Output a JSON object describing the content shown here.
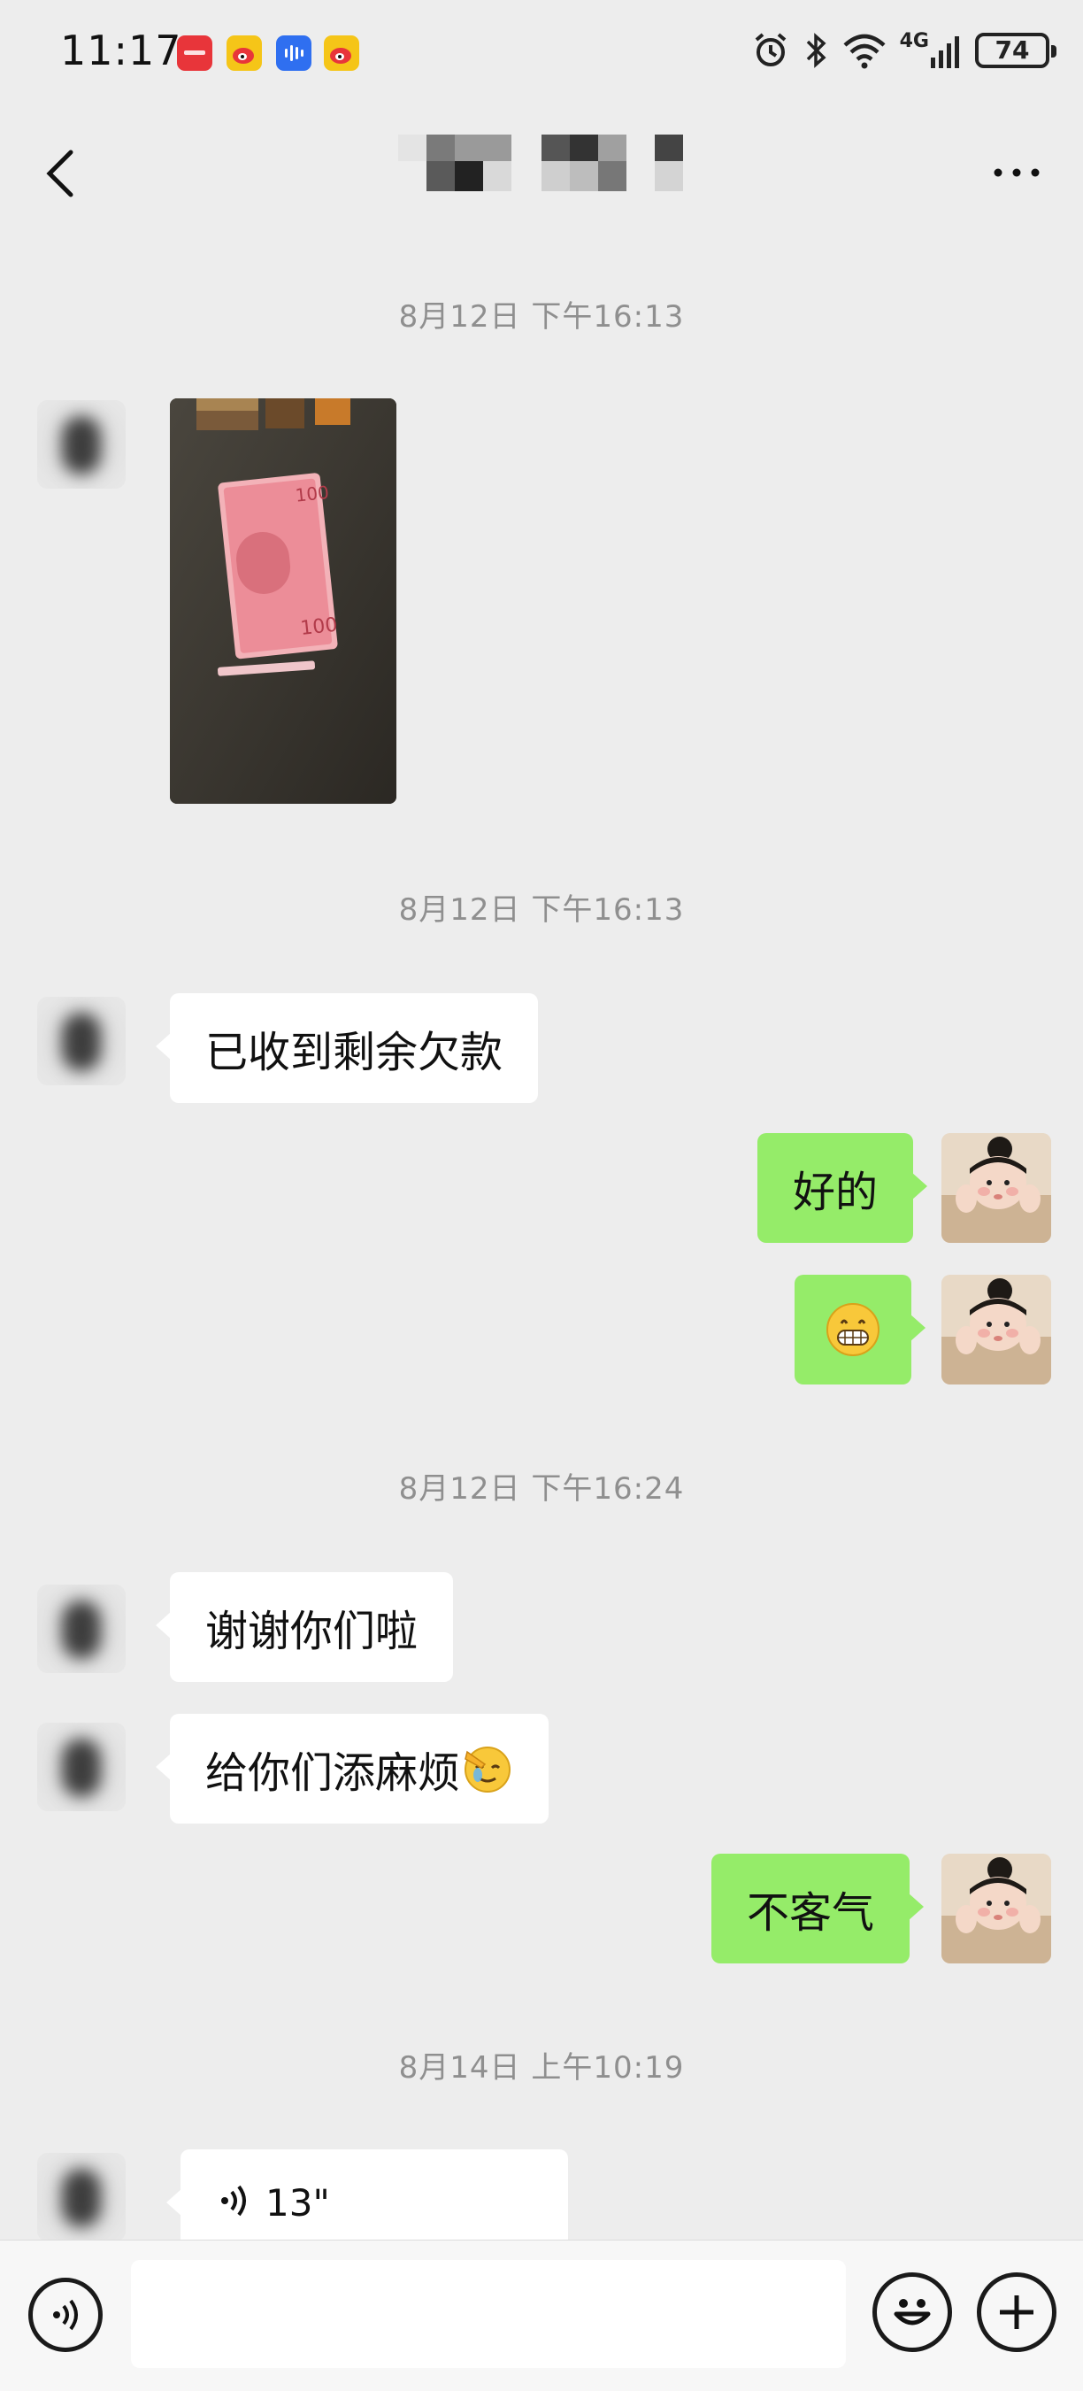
{
  "status_bar": {
    "time": "11:17",
    "network": "4G",
    "battery": "74"
  },
  "nav": {
    "title": ""
  },
  "messages": [
    {
      "type": "timestamp",
      "text": "8月12日 下午16:13"
    },
    {
      "type": "image",
      "sender": "other",
      "description": "photo of RMB 100 yuan banknotes on table"
    },
    {
      "type": "timestamp",
      "text": "8月12日 下午16:13"
    },
    {
      "type": "text",
      "sender": "other",
      "text": "已收到剩余欠款"
    },
    {
      "type": "text",
      "sender": "me",
      "text": "好的"
    },
    {
      "type": "emoji",
      "sender": "me",
      "emoji": "grinning-face"
    },
    {
      "type": "timestamp",
      "text": "8月12日 下午16:24"
    },
    {
      "type": "text",
      "sender": "other",
      "text": "谢谢你们啦"
    },
    {
      "type": "text",
      "sender": "other",
      "text": "给你们添麻烦",
      "emoji": "facepalm"
    },
    {
      "type": "text",
      "sender": "me",
      "text": "不客气"
    },
    {
      "type": "timestamp",
      "text": "8月14日 上午10:19"
    },
    {
      "type": "voice",
      "sender": "other",
      "duration": "13\""
    }
  ],
  "input_bar": {
    "placeholder": ""
  },
  "colors": {
    "background": "#ededed",
    "bubble_me": "#95ec69",
    "bubble_other": "#ffffff",
    "timestamp": "#8f8f8f"
  }
}
